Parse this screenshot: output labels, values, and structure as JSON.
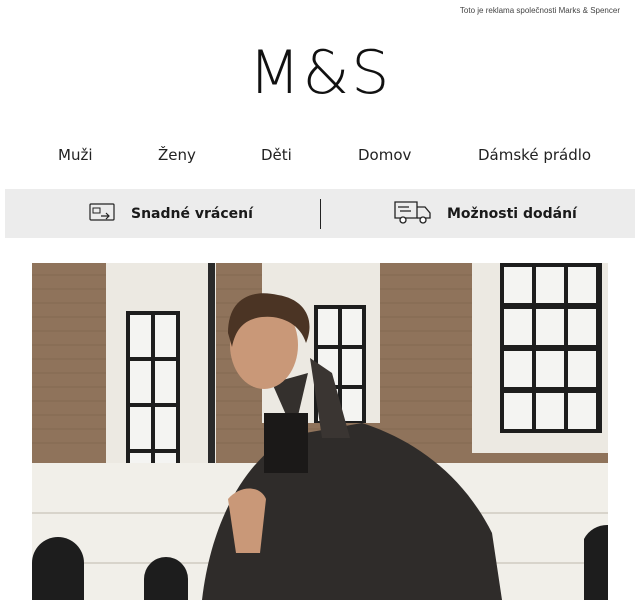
{
  "header": {
    "ad_notice": "Toto je reklama společnosti Marks & Spencer",
    "logo_text": "M&S"
  },
  "nav": {
    "items": [
      "Muži",
      "Ženy",
      "Děti",
      "Domov",
      "Dámské prádlo"
    ]
  },
  "benefits": {
    "returns_label": "Snadné vrácení",
    "delivery_label": "Možnosti dodání"
  },
  "hero": {
    "image_subject": "man-in-coat-photo"
  },
  "colors": {
    "bar_background": "#ececec",
    "brick": "#8a6f58",
    "window_frame": "#f1efe9",
    "coat": "#2f2c2a"
  }
}
